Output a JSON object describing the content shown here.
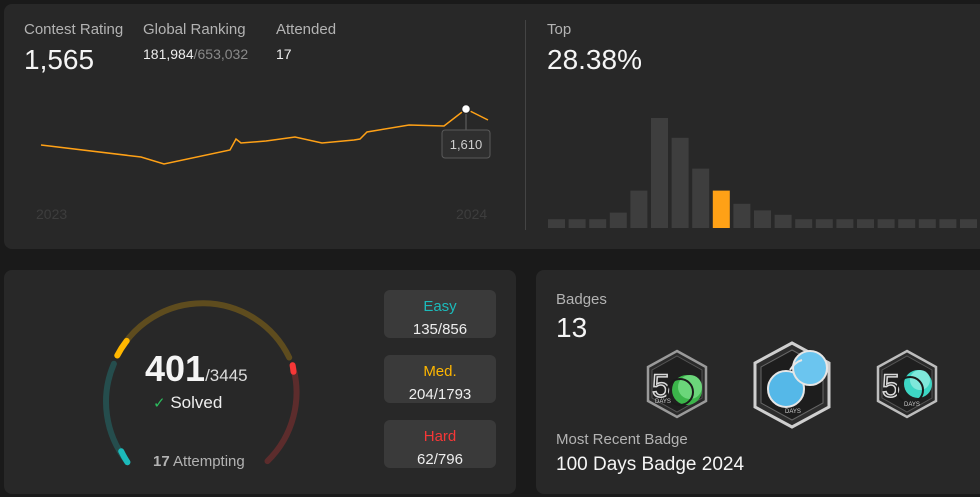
{
  "contest": {
    "rating_label": "Contest Rating",
    "rating": "1,565",
    "ranking_label": "Global Ranking",
    "ranking": "181,984",
    "ranking_total": "/653,032",
    "attended_label": "Attended",
    "attended": "17",
    "year_start": "2023",
    "year_end": "2024",
    "tooltip": "1,610",
    "line_color": "#ffa116"
  },
  "top": {
    "label": "Top",
    "value": "28.38%",
    "histogram": [
      4,
      4,
      4,
      7,
      17,
      50,
      41,
      27,
      17,
      11,
      8,
      6,
      4,
      4,
      4,
      4,
      4,
      4,
      4,
      4,
      4
    ],
    "highlight_index": 8,
    "highlight_color": "#ffa116"
  },
  "solved": {
    "count": "401",
    "total": "/3445",
    "check": "✓",
    "solved_label": "Solved",
    "attempting_count": "17",
    "attempting_label": "Attempting",
    "easy_label": "Easy",
    "easy_value": "135/856",
    "easy_color": "#1cbaba",
    "med_label": "Med.",
    "med_value": "204/1793",
    "med_color": "#ffb700",
    "hard_label": "Hard",
    "hard_value": "62/796",
    "hard_color": "#f63737"
  },
  "badges": {
    "label": "Badges",
    "count": "13",
    "recent_label": "Most Recent Badge",
    "recent_name": "100 Days Badge 2024",
    "badge_texts": [
      "DAYS",
      "DAYS",
      "DAYS"
    ]
  }
}
